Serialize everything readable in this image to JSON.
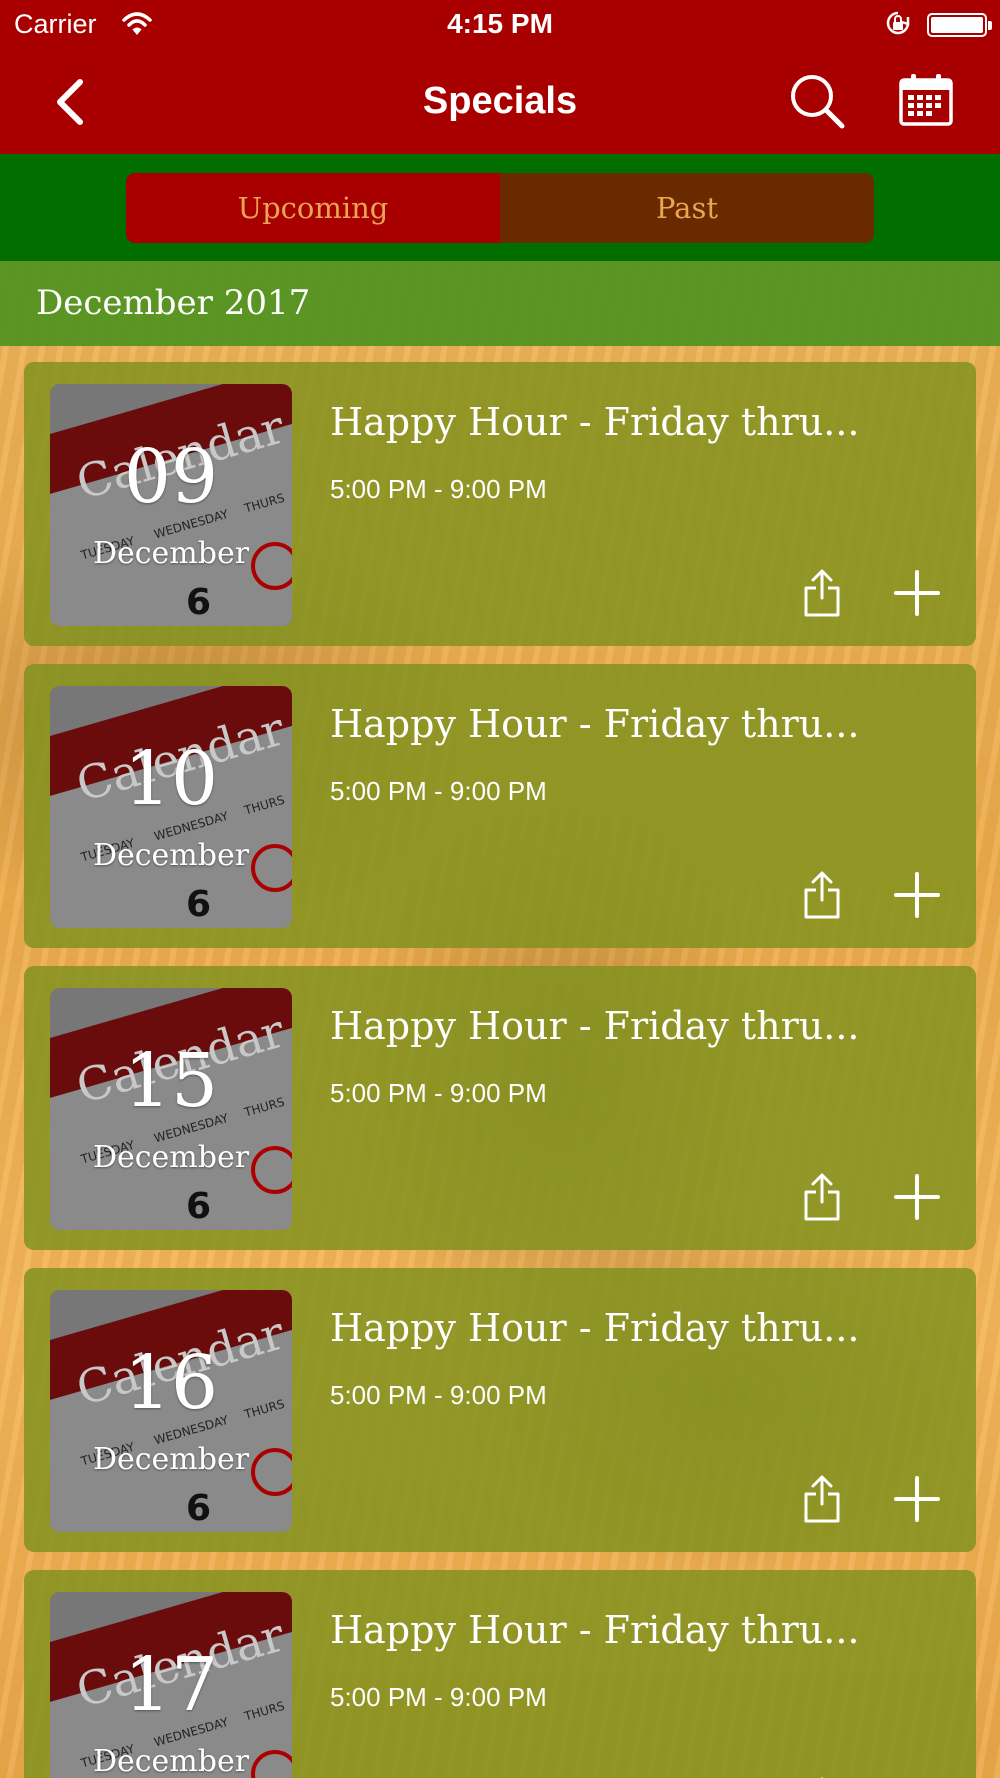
{
  "status_bar": {
    "carrier": "Carrier",
    "time": "4:15 PM",
    "icons": [
      "wifi-icon",
      "orientation-lock-icon",
      "battery-icon"
    ]
  },
  "nav": {
    "title": "Specials",
    "icons": [
      "back-chevron-icon",
      "search-icon",
      "calendar-icon"
    ]
  },
  "segments": {
    "upcoming_label": "Upcoming",
    "past_label": "Past",
    "selected": "Upcoming"
  },
  "month_header": "December 2017",
  "events": [
    {
      "day": "09",
      "month": "December",
      "title": "Happy Hour - Friday thru...",
      "time": "5:00 PM - 9:00 PM"
    },
    {
      "day": "10",
      "month": "December",
      "title": "Happy Hour - Friday thru...",
      "time": "5:00 PM - 9:00 PM"
    },
    {
      "day": "15",
      "month": "December",
      "title": "Happy Hour - Friday thru...",
      "time": "5:00 PM - 9:00 PM"
    },
    {
      "day": "16",
      "month": "December",
      "title": "Happy Hour - Friday thru...",
      "time": "5:00 PM - 9:00 PM"
    },
    {
      "day": "17",
      "month": "December",
      "title": "Happy Hour - Friday thru...",
      "time": "5:00 PM - 9:00 PM"
    }
  ],
  "thumbnail_image_text": [
    "Calendar",
    "TUESDAY",
    "WEDNESDAY",
    "THURS",
    "6"
  ],
  "colors": {
    "nav_red": "#a80000",
    "segment_green": "#006e00",
    "segment_past": "#6a2a00",
    "segment_text": "#e9a552",
    "card_olive": "#80911e"
  }
}
